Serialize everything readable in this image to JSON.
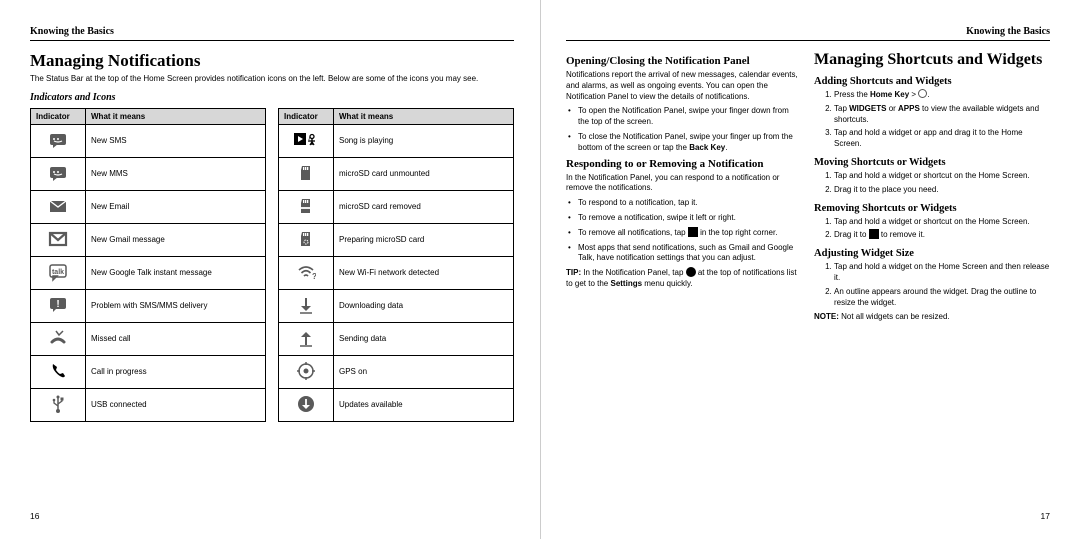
{
  "left": {
    "running_head": "Knowing the Basics",
    "h1": "Managing Notifications",
    "intro": "The Status Bar at the top of the Home Screen provides notification icons on the left. Below are some of the icons you may see.",
    "sub_heading": "Indicators and Icons",
    "th_indicator": "Indicator",
    "th_meaning": "What it means",
    "table1": [
      {
        "icon": "sms-icon",
        "txt": "New SMS"
      },
      {
        "icon": "mms-icon",
        "txt": "New MMS"
      },
      {
        "icon": "email-icon",
        "txt": "New Email"
      },
      {
        "icon": "gmail-icon",
        "txt": "New Gmail message"
      },
      {
        "icon": "talk-icon",
        "txt": "New Google Talk instant message"
      },
      {
        "icon": "problem-sms-icon",
        "txt": "Problem with SMS/MMS delivery"
      },
      {
        "icon": "missed-call-icon",
        "txt": "Missed call"
      },
      {
        "icon": "call-icon",
        "txt": "Call in progress"
      },
      {
        "icon": "usb-icon",
        "txt": "USB connected"
      }
    ],
    "table2": [
      {
        "icon": "play-icon",
        "txt": "Song is playing"
      },
      {
        "icon": "sd-unmount-icon",
        "txt": "microSD card unmounted"
      },
      {
        "icon": "sd-removed-icon",
        "txt": "microSD card removed"
      },
      {
        "icon": "sd-prep-icon",
        "txt": "Preparing microSD card"
      },
      {
        "icon": "wifi-icon",
        "txt": "New Wi-Fi network detected"
      },
      {
        "icon": "download-icon",
        "txt": "Downloading data"
      },
      {
        "icon": "upload-icon",
        "txt": "Sending data"
      },
      {
        "icon": "gps-icon",
        "txt": "GPS on"
      },
      {
        "icon": "update-icon",
        "txt": "Updates available"
      }
    ],
    "page_num": "16"
  },
  "right": {
    "running_head": "Knowing the Basics",
    "col1": {
      "h_open": "Opening/Closing the Notification Panel",
      "p_open": "Notifications report the arrival of new messages, calendar events, and alarms, as well as ongoing events. You can open the Notification Panel to view the details of notifications.",
      "li_open_1": "To open the Notification Panel, swipe your finger down from the top of the screen.",
      "li_open_2a": "To close the Notification Panel, swipe your finger up from the bottom of the screen or tap the ",
      "li_open_2b": "Back Key",
      "li_open_2c": ".",
      "h_resp": "Responding to or Removing a Notification",
      "p_resp": "In the Notification Panel, you can respond to a notification or remove the notifications.",
      "li_resp_1": "To respond to a notification, tap it.",
      "li_resp_2": "To remove a notification, swipe it left or right.",
      "li_resp_3a": "To remove all notifications, tap ",
      "li_resp_3b": " in the top right corner.",
      "li_resp_4": "Most apps that send notifications, such as Gmail and Google Talk, have notification settings that you can adjust.",
      "tip_label": "TIP:",
      "tip_a": " In the Notification Panel, tap ",
      "tip_b": " at the top of notifications list to get to the ",
      "tip_c": "Settings",
      "tip_d": " menu quickly."
    },
    "col2": {
      "h1": "Managing Shortcuts and Widgets",
      "h_add": "Adding Shortcuts and Widgets",
      "add_1a": "Press the ",
      "add_1b": "Home Key",
      "add_1c": " > ",
      "add_2a": "Tap ",
      "add_2b": "WIDGETS",
      "add_2c": " or ",
      "add_2d": "APPS",
      "add_2e": " to view the available widgets and shortcuts.",
      "add_3": "Tap and hold a widget or app and drag it to the Home Screen.",
      "h_move": "Moving Shortcuts or Widgets",
      "move_1": "Tap and hold a widget or shortcut on the Home Screen.",
      "move_2": "Drag it to the place you need.",
      "h_remove": "Removing Shortcuts or Widgets",
      "remove_1": "Tap and hold a widget or shortcut on the Home Screen.",
      "remove_2a": "Drag it to ",
      "remove_2b": " to remove it.",
      "h_size": "Adjusting Widget Size",
      "size_1": "Tap and hold a widget on the Home Screen and then release it.",
      "size_2": "An outline appears around the widget. Drag the outline to resize the widget.",
      "note_label": "NOTE:",
      "note_txt": " Not all widgets can be resized."
    },
    "page_num": "17"
  }
}
